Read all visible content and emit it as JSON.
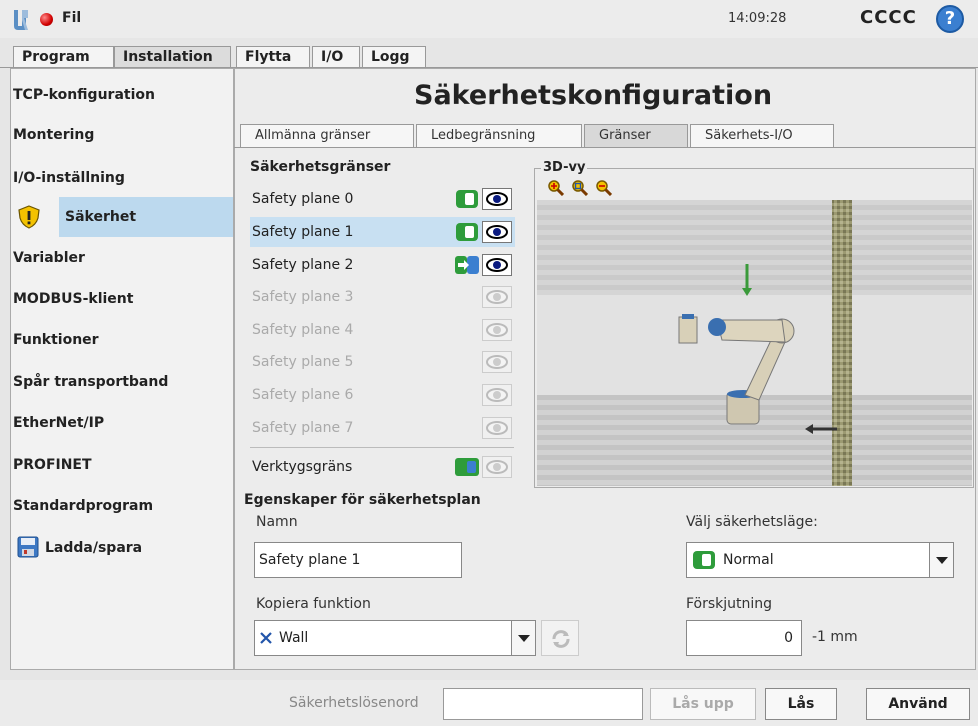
{
  "header": {
    "file_label": "Fil",
    "clock": "14:09:28",
    "robot_name": "CCCC",
    "help_symbol": "?"
  },
  "main_tabs": [
    "Program",
    "Installation",
    "Flytta",
    "I/O",
    "Logg"
  ],
  "sidebar": {
    "items": [
      {
        "label": "TCP-konfiguration"
      },
      {
        "label": "Montering"
      },
      {
        "label": "I/O-inställning"
      },
      {
        "label": "Säkerhet",
        "icon": "shield-warning-icon",
        "selected": true
      },
      {
        "label": "Variabler"
      },
      {
        "label": "MODBUS-klient"
      },
      {
        "label": "Funktioner"
      },
      {
        "label": "Spår transportband"
      },
      {
        "label": "EtherNet/IP"
      },
      {
        "label": "PROFINET"
      },
      {
        "label": "Standardprogram"
      },
      {
        "label": "Ladda/spara",
        "icon": "floppy-disk-icon"
      }
    ]
  },
  "page_title": "Säkerhetskonfiguration",
  "sub_tabs": [
    "Allmänna gränser",
    "Ledbegränsning",
    "Gränser",
    "Säkerhets-I/O"
  ],
  "limits": {
    "title": "Säkerhetsgränser",
    "planes": [
      {
        "label": "Safety plane 0",
        "state": "normal"
      },
      {
        "label": "Safety plane 1",
        "state": "normal",
        "selected": true
      },
      {
        "label": "Safety plane 2",
        "state": "trigger"
      },
      {
        "label": "Safety plane 3",
        "state": "disabled"
      },
      {
        "label": "Safety plane 4",
        "state": "disabled"
      },
      {
        "label": "Safety plane 5",
        "state": "disabled"
      },
      {
        "label": "Safety plane 6",
        "state": "disabled"
      },
      {
        "label": "Safety plane 7",
        "state": "disabled"
      }
    ],
    "tool_limit_label": "Verktygsgräns"
  },
  "view3d": {
    "title": "3D-vy"
  },
  "properties": {
    "title": "Egenskaper för säkerhetsplan",
    "name_label": "Namn",
    "name_value": "Safety plane 1",
    "copy_label": "Kopiera funktion",
    "copy_value": "Wall",
    "mode_label": "Välj säkerhetsläge:",
    "mode_value": "Normal",
    "offset_label": "Förskjutning",
    "offset_value": "0",
    "offset_unit": "-1 mm"
  },
  "footer": {
    "password_label": "Säkerhetslösenord",
    "unlock_label": "Lås upp",
    "lock_label": "Lås",
    "apply_label": "Använd"
  },
  "colors": {
    "accent_green": "#2e9c3b",
    "selection_blue": "#c8e0f2",
    "help_blue": "#3b7fd0"
  }
}
